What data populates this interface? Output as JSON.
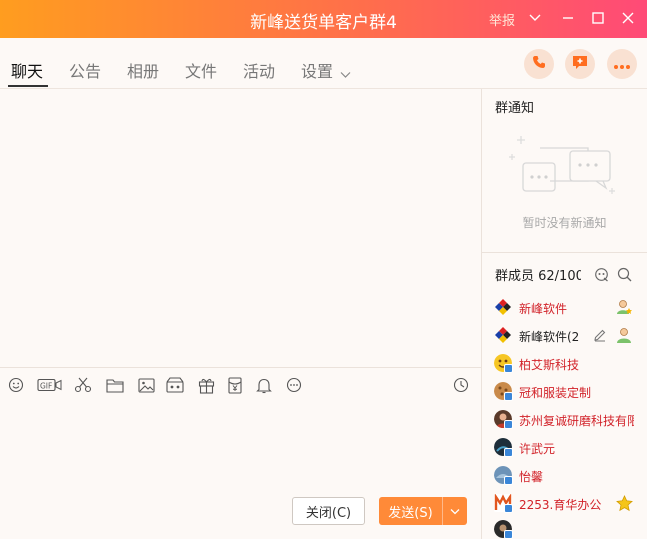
{
  "window": {
    "title": "新峰送货单客户群4",
    "report_label": "举报",
    "accent": "#ff8a38"
  },
  "tabs": [
    {
      "label": "聊天",
      "active": true
    },
    {
      "label": "公告"
    },
    {
      "label": "相册"
    },
    {
      "label": "文件"
    },
    {
      "label": "活动"
    },
    {
      "label": "设置"
    }
  ],
  "header_actions": [
    "phone-icon",
    "add-message-icon",
    "more-icon"
  ],
  "toolbar_icons": [
    "emoji-icon",
    "gif-icon",
    "scissors-icon",
    "folder-icon",
    "image-icon",
    "video-icon",
    "gift-icon",
    "red-packet-icon",
    "bell-icon",
    "more-circle-icon",
    "history-clock-icon"
  ],
  "buttons": {
    "close_label": "关闭(C)",
    "send_label": "发送(S)"
  },
  "group_notice": {
    "title": "群通知",
    "empty_text": "暂时没有新通知"
  },
  "members": {
    "title": "群成员 62/100",
    "list": [
      {
        "name": "新峰软件",
        "color": "red",
        "avatar": "tricolor"
      },
      {
        "name": "新峰软件(2",
        "color": "dark",
        "avatar": "tricolor"
      },
      {
        "name": "柏艾斯科技",
        "color": "red",
        "avatar": "emoji"
      },
      {
        "name": "冠和服装定制",
        "color": "red",
        "avatar": "cookie"
      },
      {
        "name": "苏州复诚研磨科技有限",
        "color": "red",
        "avatar": "photo"
      },
      {
        "name": "许武元",
        "color": "red",
        "avatar": "dark"
      },
      {
        "name": "怡馨",
        "color": "red",
        "avatar": "blue"
      },
      {
        "name": "2253.育华办公",
        "color": "red",
        "avatar": "mlogo"
      }
    ]
  }
}
